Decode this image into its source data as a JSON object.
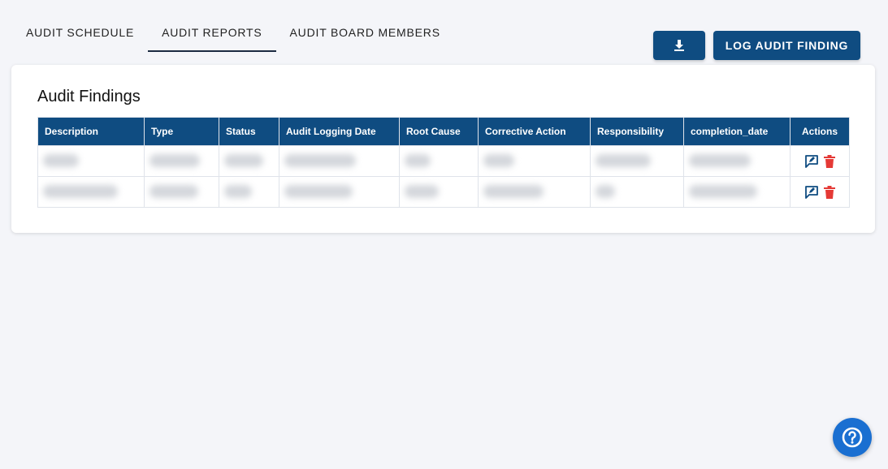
{
  "tabs": [
    {
      "label": "AUDIT SCHEDULE",
      "active": false
    },
    {
      "label": "AUDIT REPORTS",
      "active": true
    },
    {
      "label": "AUDIT BOARD MEMBERS",
      "active": false
    }
  ],
  "toolbar": {
    "download_icon": "download-icon",
    "log_label": "LOG AUDIT FINDING"
  },
  "findings": {
    "title": "Audit Findings",
    "columns": [
      "Description",
      "Type",
      "Status",
      "Audit Logging Date",
      "Root Cause",
      "Corrective Action",
      "Responsibility",
      "completion_date",
      "Actions"
    ],
    "rows": [
      {
        "cells_redacted": true,
        "actions": [
          "feedback-edit-icon",
          "delete-icon"
        ]
      },
      {
        "cells_redacted": true,
        "actions": [
          "feedback-edit-icon",
          "delete-icon"
        ]
      }
    ]
  },
  "colors": {
    "primary": "#0f4c81",
    "delete": "#e53935",
    "help": "#1a6fd1",
    "background": "#f4f5f9"
  },
  "help_icon": "question-circle-icon"
}
